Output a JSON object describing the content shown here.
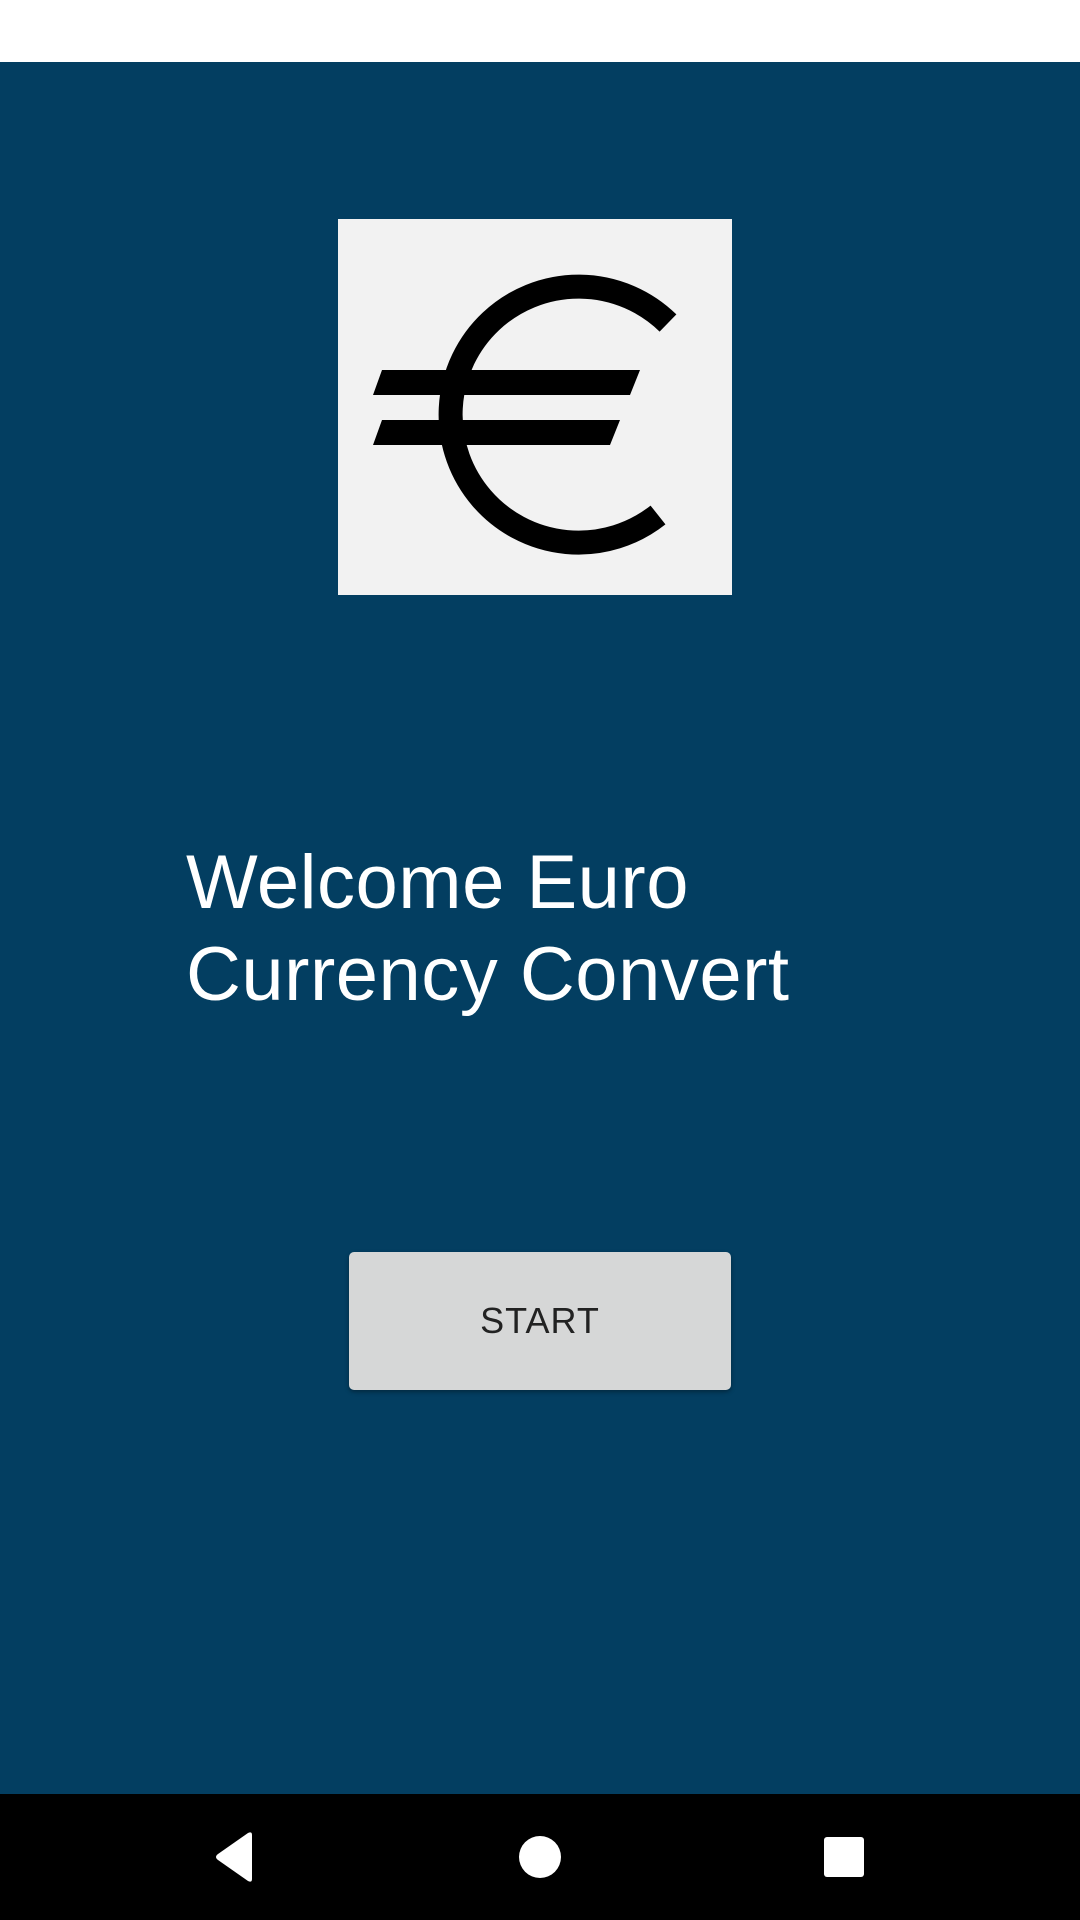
{
  "app": {
    "background_color": "#033e61",
    "logo": {
      "icon": "euro-icon",
      "background_color": "#f2f2f2"
    },
    "welcome_text": "Welcome Euro Currency Convert",
    "start_button": {
      "label": "START",
      "background_color": "#d6d7d7"
    }
  },
  "navigation_bar": {
    "back_icon": "back-triangle-icon",
    "home_icon": "home-circle-icon",
    "recents_icon": "recents-square-icon"
  }
}
